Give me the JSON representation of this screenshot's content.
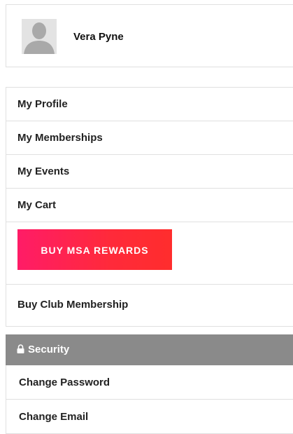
{
  "user": {
    "name": "Vera Pyne"
  },
  "menu": {
    "items": [
      {
        "label": "My Profile"
      },
      {
        "label": "My Memberships"
      },
      {
        "label": "My Events"
      },
      {
        "label": "My Cart"
      }
    ],
    "rewards_button": "BUY MSA REWARDS",
    "club_membership": "Buy Club Membership"
  },
  "security": {
    "header": "Security",
    "icon": "lock-icon",
    "items": [
      {
        "label": "Change Password"
      },
      {
        "label": "Change Email"
      }
    ]
  },
  "colors": {
    "rewards_start": "#ff1c67",
    "rewards_end": "#ff2d2d",
    "security_header_bg": "#8a8a8a"
  }
}
